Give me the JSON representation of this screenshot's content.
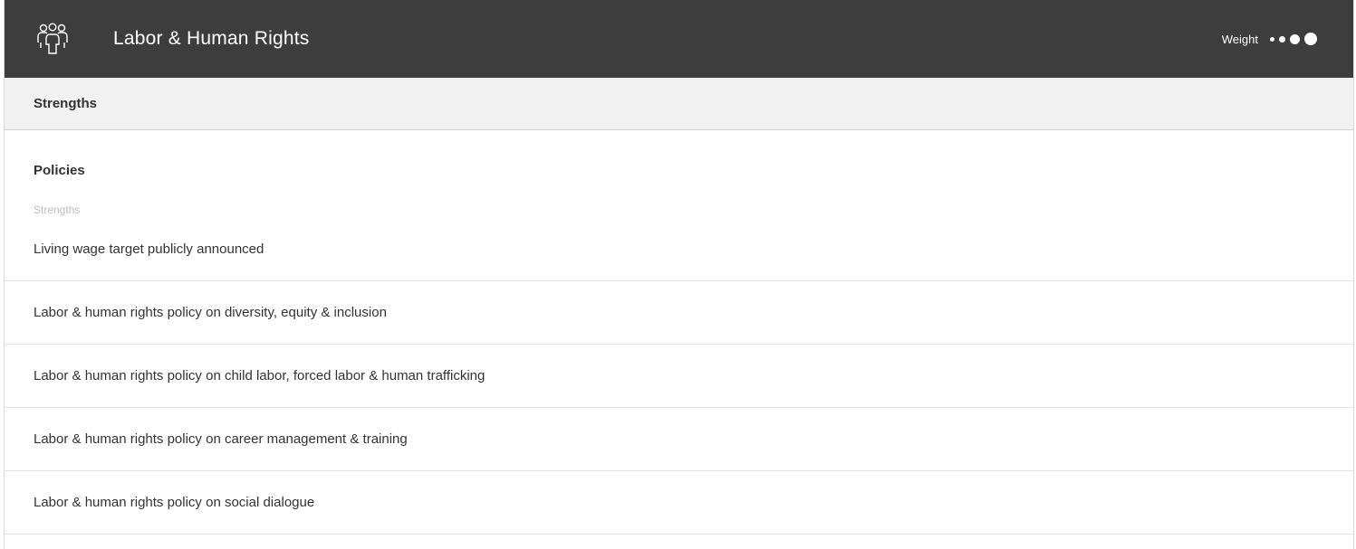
{
  "header": {
    "title": "Labor & Human Rights",
    "icon": "people-group-icon",
    "weight_label": "Weight",
    "weight_level": 4,
    "weight_max": 4
  },
  "section": {
    "label": "Strengths"
  },
  "group": {
    "title": "Policies",
    "sublabel": "Strengths",
    "items": [
      "Living wage target publicly announced",
      "Labor & human rights policy on diversity, equity & inclusion",
      "Labor & human rights policy on child labor, forced labor & human trafficking",
      "Labor & human rights policy on career management & training",
      "Labor & human rights policy on social dialogue"
    ]
  },
  "colors": {
    "header_bg": "#3d3d3d",
    "section_bg": "#f1f1f1",
    "text": "#333333",
    "muted": "#bdbdbd"
  }
}
